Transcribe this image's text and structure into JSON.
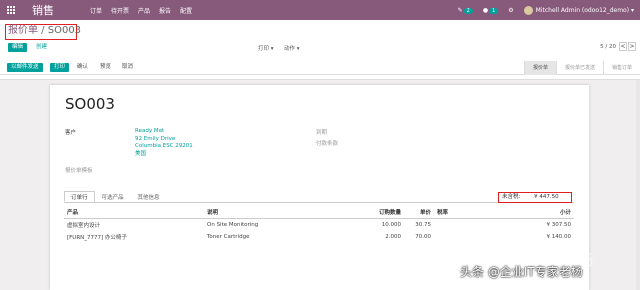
{
  "topbar": {
    "brand": "销售",
    "menu": [
      "订单",
      "待开票",
      "产品",
      "报告",
      "配置"
    ],
    "chat_count": "2",
    "activity_count": "1",
    "user": "Mitchell Admin (odoo12_demo)"
  },
  "breadcrumb": {
    "parent": "报价单",
    "sep": " / ",
    "current": "SO003"
  },
  "control": {
    "edit": "编辑",
    "create": "创建",
    "print": "打印",
    "action": "动作",
    "pager": "5 / 20",
    "prev": "<",
    "next": ">"
  },
  "statusbar": {
    "buttons": [
      "以邮件发送",
      "打印",
      "确认",
      "预览",
      "取消"
    ],
    "stages": [
      "报价单",
      "报价单已发送",
      "销售订单"
    ]
  },
  "form": {
    "title": "SO003",
    "customer_label": "客户",
    "address": [
      "Ready Mat",
      "92 Emily Drive",
      "Columbia ESC 29201",
      "美国"
    ],
    "expiration_label": "到期",
    "payment_terms_label": "付款条款",
    "template_label": "报价单模板",
    "tabs": [
      "订单行",
      "可选产品",
      "其他信息"
    ],
    "columns": [
      "产品",
      "说明",
      "订购数量",
      "单价",
      "税率",
      "小计"
    ],
    "rows": [
      {
        "product": "虚拟室内设计",
        "desc": "On Site Monitoring",
        "qty": "10.000",
        "price": "30.75",
        "tax": "",
        "subtotal": "¥ 307.50"
      },
      {
        "product": "[FURN_7777] 办公椅子",
        "desc": "Toner Cartridge",
        "qty": "2.000",
        "price": "70.00",
        "tax": "",
        "subtotal": "¥ 140.00"
      }
    ],
    "total_label": "未含税:",
    "total_value": "¥ 447.50"
  },
  "watermark": {
    "line1": "知乎 @企业IT专家老杨",
    "line2": "头条 @企业IT专家老杨"
  }
}
